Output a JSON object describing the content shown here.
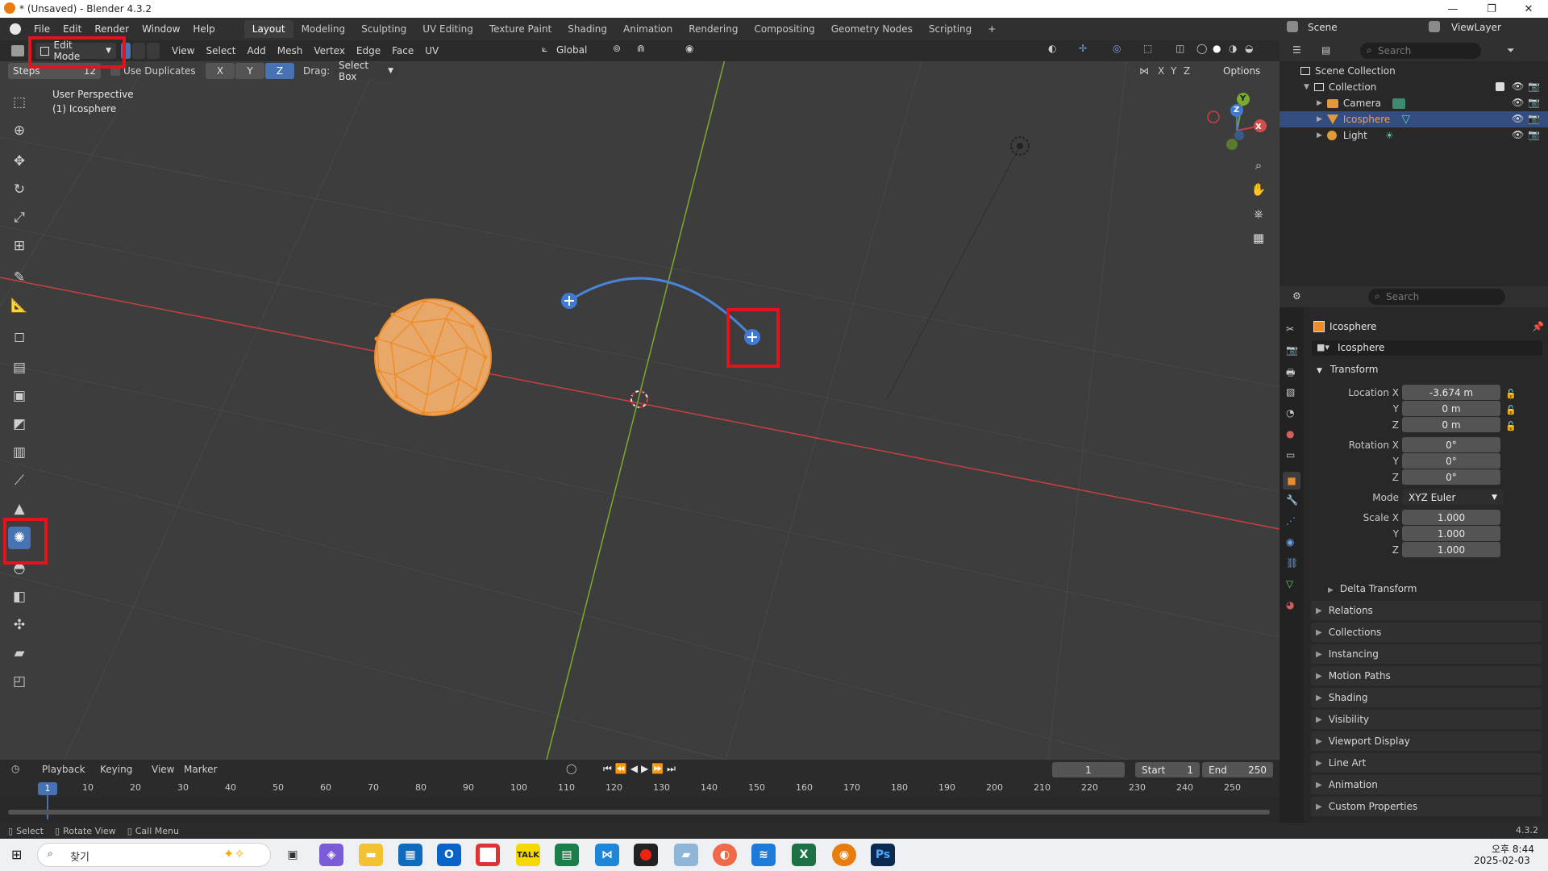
{
  "window": {
    "title": "* (Unsaved) - Blender 4.3.2",
    "minimize": "—",
    "maximize": "❐",
    "close": "✕"
  },
  "menu": {
    "items": [
      "File",
      "Edit",
      "Render",
      "Window",
      "Help"
    ]
  },
  "workspaces": {
    "tabs": [
      "Layout",
      "Modeling",
      "Sculpting",
      "UV Editing",
      "Texture Paint",
      "Shading",
      "Animation",
      "Rendering",
      "Compositing",
      "Geometry Nodes",
      "Scripting"
    ],
    "active": "Layout",
    "add": "+"
  },
  "top_right": {
    "scene": "Scene",
    "view_layer": "ViewLayer"
  },
  "viewport_header": {
    "mode": "Edit Mode",
    "menus": [
      "View",
      "Select",
      "Add",
      "Mesh",
      "Vertex",
      "Edge",
      "Face",
      "UV"
    ],
    "orientation": "Global"
  },
  "tool_options": {
    "steps_label": "Steps",
    "steps_value": "12",
    "use_duplicates": "Use Duplicates",
    "axis_x": "X",
    "axis_y": "Y",
    "axis_z": "Z",
    "drag_label": "Drag:",
    "drag_value": "Select Box",
    "options": "Options",
    "mirror_x": "X",
    "mirror_y": "Y",
    "mirror_z": "Z"
  },
  "viewport": {
    "perspective": "User Perspective",
    "object_label": "(1) Icosphere",
    "gizmo": {
      "x": "X",
      "y": "Y",
      "z": "Z"
    }
  },
  "outliner": {
    "search_placeholder": "Search",
    "root": "Scene Collection",
    "collection": "Collection",
    "items": [
      {
        "name": "Camera"
      },
      {
        "name": "Icosphere"
      },
      {
        "name": "Light"
      }
    ]
  },
  "properties": {
    "search_placeholder": "Search",
    "object_name": "Icosphere",
    "data_name": "Icosphere",
    "transform": {
      "header": "Transform",
      "location_label": "Location X",
      "loc_x": "-3.674 m",
      "loc_y": "0 m",
      "loc_z": "0 m",
      "rotation_label": "Rotation X",
      "rot_x": "0°",
      "rot_y": "0°",
      "rot_z": "0°",
      "mode_label": "Mode",
      "mode_value": "XYZ Euler",
      "scale_label": "Scale X",
      "scale_x": "1.000",
      "scale_y": "1.000",
      "scale_z": "1.000",
      "y": "Y",
      "z": "Z"
    },
    "panels": [
      "Delta Transform",
      "Relations",
      "Collections",
      "Instancing",
      "Motion Paths",
      "Shading",
      "Visibility",
      "Viewport Display",
      "Line Art",
      "Animation",
      "Custom Properties"
    ]
  },
  "timeline": {
    "menus": [
      "Playback",
      "Keying",
      "View",
      "Marker"
    ],
    "current_frame": "1",
    "start_label": "Start",
    "start": "1",
    "end_label": "End",
    "end": "250",
    "ticks": [
      "10",
      "20",
      "30",
      "40",
      "50",
      "60",
      "70",
      "80",
      "90",
      "100",
      "110",
      "120",
      "130",
      "140",
      "150",
      "160",
      "170",
      "180",
      "190",
      "200",
      "210",
      "220",
      "230",
      "240",
      "250"
    ],
    "playhead": "1"
  },
  "statusbar": {
    "select": "Select",
    "rotate": "Rotate View",
    "call_menu": "Call Menu",
    "version": "4.3.2"
  },
  "taskbar": {
    "search": "찾기",
    "time": "오후 8:44",
    "date": "2025-02-03"
  },
  "colors": {
    "accent": "#4772b3",
    "highlight": "#e0141a",
    "mesh": "#f08c28",
    "x_axis": "#c8403f",
    "y_axis": "#7aaa2e"
  }
}
